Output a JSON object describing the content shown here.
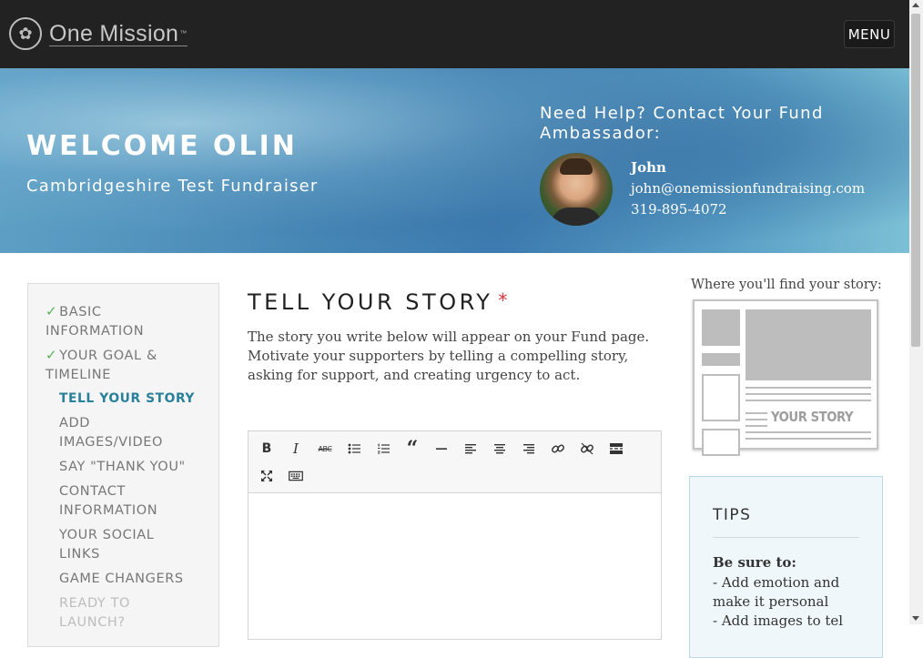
{
  "header": {
    "logo_text": "One Mission",
    "logo_tm": "™",
    "menu_label": "MENU"
  },
  "hero": {
    "welcome": "WELCOME OLIN",
    "fundraiser_name": "Cambridgeshire Test Fundraiser",
    "help_title": "Need Help? Contact Your Fund Ambassador:",
    "ambassador": {
      "name": "John",
      "email": "john@onemissionfundraising.com",
      "phone": "319-895-4072"
    }
  },
  "sidebar": {
    "steps": [
      {
        "label": "BASIC INFORMATION",
        "state": "done"
      },
      {
        "label": "YOUR GOAL & TIMELINE",
        "state": "done"
      },
      {
        "label": "TELL YOUR STORY",
        "state": "active"
      },
      {
        "label": "ADD IMAGES/VIDEO",
        "state": "todo"
      },
      {
        "label": "SAY \"THANK YOU\"",
        "state": "todo"
      },
      {
        "label": "CONTACT INFORMATION",
        "state": "todo"
      },
      {
        "label": "YOUR SOCIAL LINKS",
        "state": "todo"
      },
      {
        "label": "GAME CHANGERS",
        "state": "todo"
      },
      {
        "label": "READY TO LAUNCH?",
        "state": "disabled"
      }
    ],
    "check_glyph": "✓"
  },
  "main": {
    "title": "TELL YOUR STORY",
    "required_mark": "*",
    "description": "The story you write below will appear on your Fund page. Motivate your supporters by telling a compelling story, asking for support, and creating urgency to act.",
    "editor": {
      "toolbar": [
        "bold-icon",
        "italic-icon",
        "strikethrough-icon",
        "bulleted-list-icon",
        "numbered-list-icon",
        "blockquote-icon",
        "horizontal-rule-icon",
        "align-left-icon",
        "align-center-icon",
        "align-right-icon",
        "link-icon",
        "unlink-icon",
        "read-more-icon",
        "fullscreen-icon",
        "keyboard-icon"
      ],
      "content": ""
    }
  },
  "right": {
    "find_label": "Where you'll find your story:",
    "preview_text": "YOUR STORY",
    "tips": {
      "title": "TIPS",
      "subtitle": "Be sure to:",
      "items": [
        "- Add emotion and make it personal",
        "- Add images to tel"
      ]
    }
  },
  "colors": {
    "header_bg": "#222222",
    "active_step": "#28809a",
    "done_check": "#58b058",
    "required": "#d9343a",
    "tips_bg": "#f0f7fa"
  }
}
